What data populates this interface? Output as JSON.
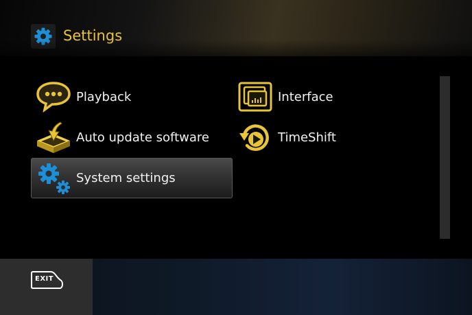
{
  "header": {
    "title": "Settings",
    "icon": "gear-icon"
  },
  "menu": {
    "items": [
      {
        "label": "Playback",
        "icon": "speech-bubble-icon",
        "selected": false
      },
      {
        "label": "Interface",
        "icon": "interface-screen-icon",
        "selected": false
      },
      {
        "label": "Auto update software",
        "icon": "download-box-icon",
        "selected": false
      },
      {
        "label": "TimeShift",
        "icon": "timeshift-play-icon",
        "selected": false
      },
      {
        "label": "System settings",
        "icon": "gears-icon",
        "selected": true
      }
    ]
  },
  "footer": {
    "exit_label": "EXIT",
    "exit_icon": "exit-key-icon"
  },
  "colors": {
    "accent": "#e8c437",
    "icon_blue": "#1e8fd6",
    "text": "#f2f2f2",
    "background": "#000000"
  }
}
